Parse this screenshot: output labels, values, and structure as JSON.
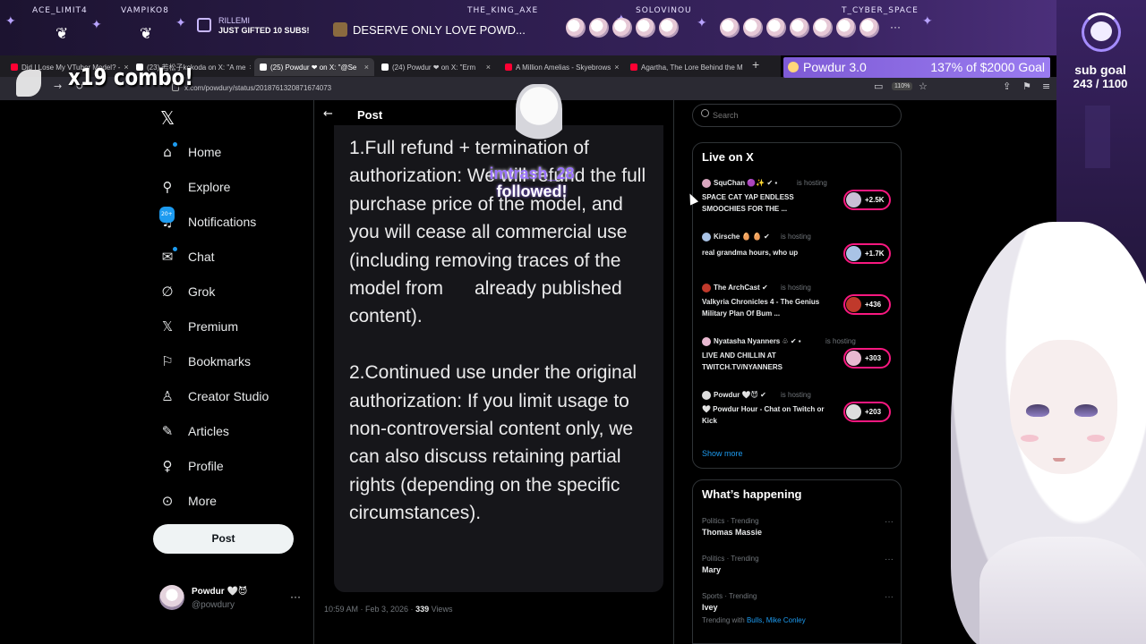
{
  "stream": {
    "events": [
      {
        "name": "ACE_LIMIT4"
      },
      {
        "name": "VAMPIKO8"
      },
      {
        "name": "THE_KING_AXE"
      },
      {
        "name": "SOLOVINOU"
      },
      {
        "name": "T_CYBER_SPACE"
      }
    ],
    "gift": {
      "user": "RILLEMI",
      "text": "JUST GIFTED 10 SUBS!"
    },
    "chat_message": "DESERVE ONLY LOVE POWD...",
    "donation": {
      "name": "Powdur 3.0",
      "progress": "137% of $2000 Goal"
    },
    "sub_goal": {
      "label": "sub goal",
      "count": "243 / 1100"
    },
    "combo": "x19 combo!",
    "follow_alert": {
      "user": "imtrash_28",
      "text": "followed!"
    }
  },
  "browser": {
    "tabs": [
      {
        "title": "Did I Lose My VTuber Model? -",
        "fav_color": "#ff0033"
      },
      {
        "title": "(23) 若松子kokoda on X: \"A me",
        "fav_color": "#ffffff"
      },
      {
        "title": "(25) Powdur ❤ on X: \"@Se",
        "fav_color": "#ffffff",
        "active": true
      },
      {
        "title": "(24) Powdur ❤ on X: \"Erm",
        "fav_color": "#ffffff"
      },
      {
        "title": "A Million Amelias - Skyebrows",
        "fav_color": "#ff0033"
      },
      {
        "title": "Agartha, The Lore Behind the M",
        "fav_color": "#ff0033"
      }
    ],
    "url": "x.com/powdury/status/2018761320871674073",
    "zoom": "110%"
  },
  "nav": {
    "items": [
      {
        "label": "Home",
        "icon": "home-icon"
      },
      {
        "label": "Explore",
        "icon": "search-icon"
      },
      {
        "label": "Notifications",
        "icon": "bell-icon",
        "badge": "20+"
      },
      {
        "label": "Chat",
        "icon": "mail-icon"
      },
      {
        "label": "Grok",
        "icon": "grok-icon"
      },
      {
        "label": "Premium",
        "icon": "x-icon"
      },
      {
        "label": "Bookmarks",
        "icon": "bookmark-icon"
      },
      {
        "label": "Creator Studio",
        "icon": "creator-icon"
      },
      {
        "label": "Articles",
        "icon": "article-icon"
      },
      {
        "label": "Profile",
        "icon": "person-icon"
      },
      {
        "label": "More",
        "icon": "more-icon"
      }
    ],
    "post_button": "Post",
    "account": {
      "name": "Powdur 🤍😈",
      "handle": "@powdury"
    }
  },
  "post": {
    "header": "Post",
    "body": "1.Full refund + termination of authorization: We will refund the full purchase price of the model, and you will cease all commercial use (including removing traces of the model from      already published content).\n\n2.Continued use under the original authorization: If you limit usage to non-controversial content only, we can also discuss retaining partial rights (depending on the specific circumstances).",
    "time": "10:59 AM · Feb 3, 2026 · ",
    "views_count": "339",
    "views_label": " Views"
  },
  "sidebar": {
    "search_placeholder": "Search",
    "live": {
      "title": "Live on X",
      "items": [
        {
          "host": "SquChan 🟣✨ ✔ ▪",
          "desc": "SPACE CAT YAP ENDLESS SMOOCHIES FOR THE ...",
          "count": "+2.5K"
        },
        {
          "host": "Kirsche 🥚 🥚 ✔",
          "desc": "real grandma hours, who up",
          "count": "+1.7K"
        },
        {
          "host": "The ArchCast ✔",
          "desc": "Valkyria Chronicles 4 - The Genius Military Plan Of Bum ...",
          "count": "+436"
        },
        {
          "host": "Nyatasha Nyanners ♧ ✔ ▪",
          "desc": "LIVE AND CHILLIN AT TWITCH.TV/NYANNERS",
          "count": "+303"
        },
        {
          "host": "Powdur 🤍😈 ✔",
          "desc": "🤍 Powdur Hour - Chat on Twitch or Kick",
          "count": "+203"
        }
      ],
      "hosting_label": "is hosting",
      "show_more": "Show more"
    },
    "happening": {
      "title": "What’s happening",
      "trends": [
        {
          "category": "Politics · Trending",
          "name": "Thomas Massie"
        },
        {
          "category": "Politics · Trending",
          "name": "Mary"
        },
        {
          "category": "Sports · Trending",
          "name": "Ivey"
        }
      ],
      "cut_prefix": "Trending with ",
      "cut_link": "Bulls, Mike Conley"
    }
  }
}
